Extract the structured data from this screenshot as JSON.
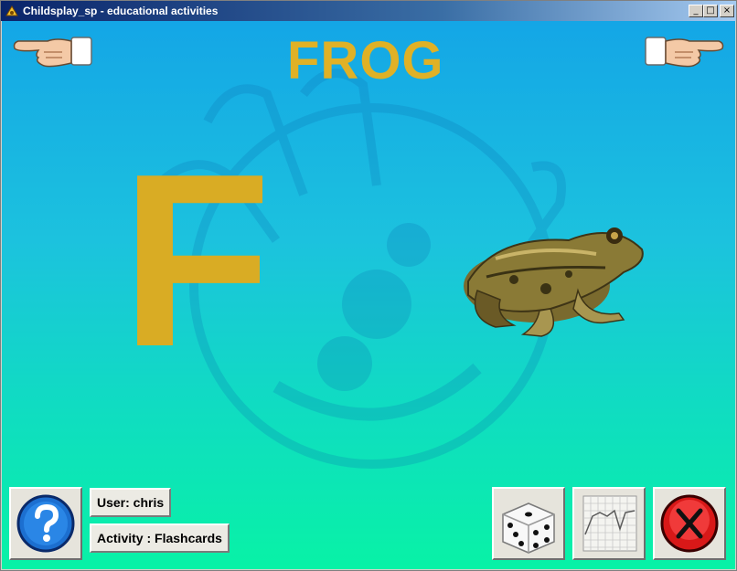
{
  "window": {
    "title": "Childsplay_sp - educational activities",
    "controls": {
      "minimize": "_",
      "maximize": "□",
      "close": "×"
    }
  },
  "flashcard": {
    "word": "FROG",
    "letter": "F",
    "picture": "frog-image"
  },
  "navigation": {
    "previous_icon": "pointing-hand-left-icon",
    "next_icon": "pointing-hand-right-icon"
  },
  "status": {
    "user": "User: chris",
    "activity": "Activity : Flashcards"
  },
  "toolbar": {
    "help_icon": "question-mark-icon",
    "dice_icon": "dice-icon",
    "graph_icon": "graph-icon",
    "quit_icon": "red-x-icon"
  },
  "colors": {
    "word": "#e0b126",
    "letter": "#d9ac24",
    "background_top": "#14a6e6",
    "background_bottom": "#08f2a6",
    "quit": "#d81818",
    "help": "#1c6fd0"
  }
}
